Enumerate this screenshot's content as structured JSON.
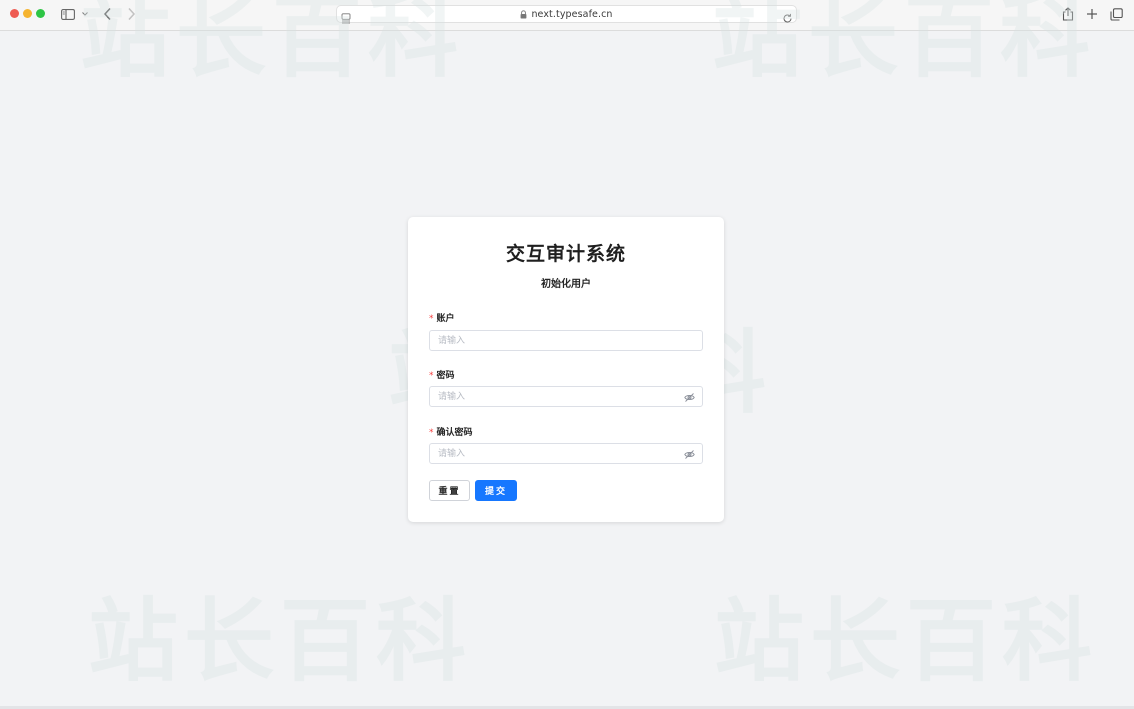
{
  "browser": {
    "url": "next.typesafe.cn",
    "icons": {
      "sidebar": "sidebar-icon",
      "back": "chevron-left-icon",
      "forward": "chevron-right-icon",
      "reader": "reader-icon",
      "lock": "lock-icon",
      "reload": "reload-icon",
      "share": "share-icon",
      "new_tab": "plus-icon",
      "tabs": "tabs-overview-icon"
    }
  },
  "watermark": {
    "text": "站长百科"
  },
  "login": {
    "title": "交互审计系统",
    "subtitle": "初始化用户",
    "required_mark": "*",
    "fields": {
      "account": {
        "label": "账户",
        "placeholder": "请输入",
        "value": ""
      },
      "password": {
        "label": "密码",
        "placeholder": "请输入",
        "value": ""
      },
      "confirm_password": {
        "label": "确认密码",
        "placeholder": "请输入",
        "value": ""
      }
    },
    "buttons": {
      "reset": "重置",
      "submit": "提交"
    }
  },
  "colors": {
    "primary": "#1677ff",
    "required": "#f53f3f",
    "page_background": "#f2f3f5",
    "card_background": "#ffffff"
  }
}
